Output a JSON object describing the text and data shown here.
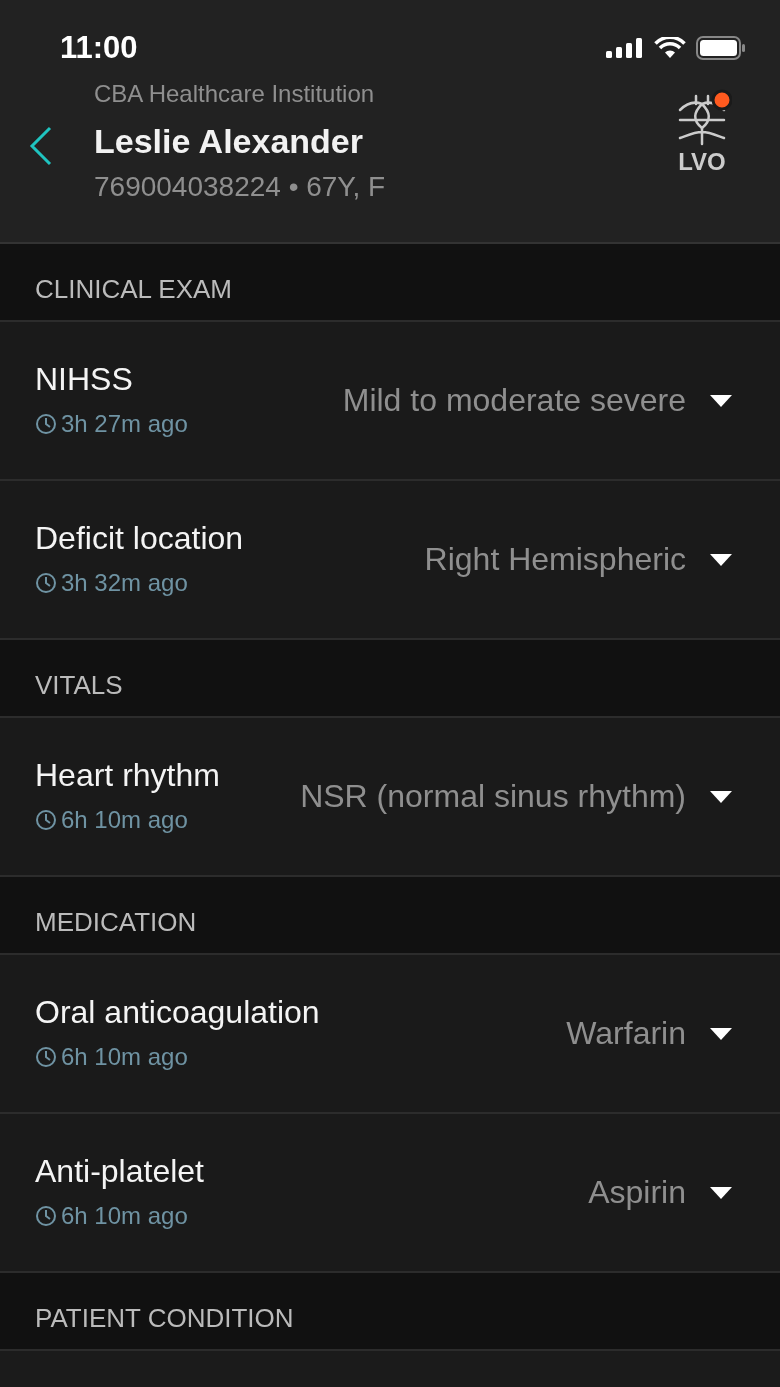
{
  "status_bar": {
    "time": "11:00"
  },
  "header": {
    "institution": "CBA Healthcare Institution",
    "patient_name": "Leslie Alexander",
    "patient_info": "769004038224 • 67Y, F",
    "badge": {
      "label": "LVO",
      "alert": true
    }
  },
  "sections": [
    {
      "title": "CLINICAL EXAM",
      "items": [
        {
          "label": "NIHSS",
          "time": "3h 27m ago",
          "value": "Mild to moderate severe"
        },
        {
          "label": "Deficit location",
          "time": "3h 32m ago",
          "value": "Right Hemispheric"
        }
      ]
    },
    {
      "title": "VITALS",
      "items": [
        {
          "label": "Heart rhythm",
          "time": "6h 10m ago",
          "value": "NSR (normal sinus rhythm)"
        }
      ]
    },
    {
      "title": "MEDICATION",
      "items": [
        {
          "label": "Oral anticoagulation",
          "time": "6h 10m ago",
          "value": "Warfarin"
        },
        {
          "label": "Anti-platelet",
          "time": "6h 10m ago",
          "value": "Aspirin"
        }
      ]
    },
    {
      "title": "PATIENT CONDITION"
    }
  ]
}
